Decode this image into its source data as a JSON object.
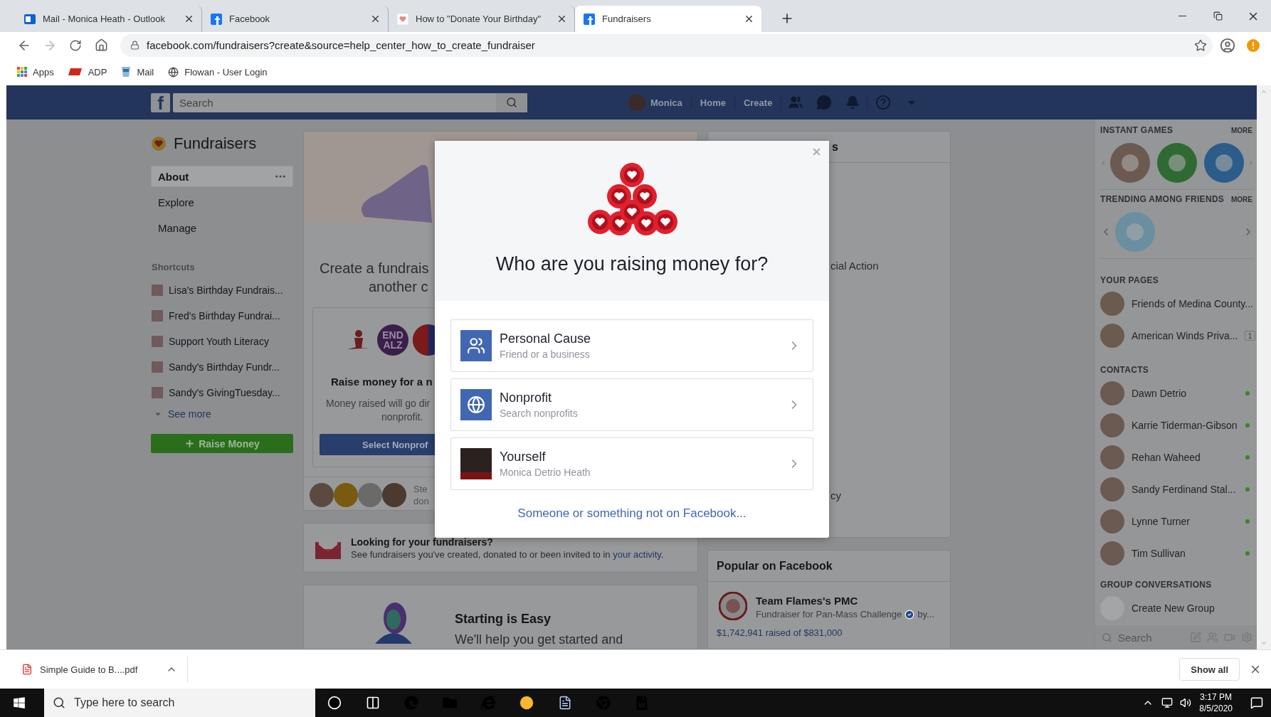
{
  "browser": {
    "tabs": [
      {
        "title": "Mail - Monica Heath - Outlook",
        "kind": "mail",
        "selected": false
      },
      {
        "title": "Facebook",
        "kind": "facebook",
        "selected": false
      },
      {
        "title": "How to \"Donate Your Birthday\"",
        "kind": "help",
        "selected": false
      },
      {
        "title": "Fundraisers",
        "kind": "facebook",
        "selected": true
      }
    ],
    "url": "facebook.com/fundraisers?create&source=help_center_how_to_create_fundraiser",
    "bookmarks": [
      {
        "label": "Apps",
        "kind": "apps"
      },
      {
        "label": "ADP",
        "kind": "adp"
      },
      {
        "label": "Mail",
        "kind": "cup"
      },
      {
        "label": "Flowan - User Login",
        "kind": "globe"
      }
    ]
  },
  "topbar": {
    "logo": "f",
    "search_placeholder": "Search",
    "profile_name": "Monica",
    "links": [
      "Home",
      "Create"
    ]
  },
  "sidebar": {
    "title": "Fundraisers",
    "nav": [
      {
        "label": "About",
        "selected": true
      },
      {
        "label": "Explore",
        "selected": false
      },
      {
        "label": "Manage",
        "selected": false
      }
    ],
    "shortcuts_heading": "Shortcuts",
    "shortcuts": [
      {
        "label": "Lisa's Birthday Fundrais..."
      },
      {
        "label": "Fred's Birthday Fundrai..."
      },
      {
        "label": "Support Youth Literacy"
      },
      {
        "label": "Sandy's Birthday Fundr..."
      },
      {
        "label": "Sandy's GivingTuesday..."
      }
    ],
    "see_more": "See more",
    "raise_button": "Raise Money"
  },
  "create_card": {
    "heading_lines": [
      "Create a fundrais",
      "another c"
    ],
    "logos": [
      {
        "kind": "figure"
      },
      {
        "kind": "text",
        "lines": [
          "END",
          "ALZ"
        ]
      },
      {
        "kind": "seal"
      }
    ],
    "title": "Raise money for a n",
    "body_lines": [
      "Money raised will go dir",
      "nonprofit."
    ],
    "button": "Select Nonprof",
    "donors_text_lines": [
      "Ste",
      "don"
    ]
  },
  "activity_card": {
    "title": "Looking for your fundraisers?",
    "text": "See fundraisers you've created, donated to or been invited to in",
    "link": "your activity",
    "after": "."
  },
  "starting_card": {
    "title": "Starting is Easy",
    "text": "We'll help you get started and"
  },
  "side_card": {
    "header": "s",
    "lines": [
      "cial Action",
      "cy"
    ]
  },
  "popular": {
    "heading": "Popular on Facebook",
    "item": {
      "title": "Team Flames's PMC",
      "subtitle": "Fundraiser for Pan-Mass Challenge",
      "verified": true,
      "after": "by...",
      "amount": "$1,742,941 raised of $831,000"
    }
  },
  "chat": {
    "games_heading": "INSTANT GAMES",
    "games_more": "MORE",
    "games": [
      {
        "kind": "word"
      },
      {
        "kind": "cards"
      },
      {
        "kind": "pool"
      }
    ],
    "trending_heading": "TRENDING AMONG FRIENDS",
    "trending_more": "MORE",
    "trending": [
      {
        "kind": "sweets"
      }
    ],
    "pages_heading": "YOUR PAGES",
    "pages": [
      {
        "name": "Friends of Medina County..."
      },
      {
        "name": "American Winds Priva...",
        "badge": "1"
      }
    ],
    "contacts_heading": "CONTACTS",
    "contacts": [
      {
        "name": "Dawn Detrio",
        "online": true
      },
      {
        "name": "Karrie Tiderman-Gibson",
        "online": true
      },
      {
        "name": "Rehan Waheed",
        "online": true
      },
      {
        "name": "Sandy Ferdinand Stal...",
        "online": true
      },
      {
        "name": "Lynne Turner",
        "online": true
      },
      {
        "name": "Tim Sullivan",
        "online": true
      }
    ],
    "groups_heading": "GROUP CONVERSATIONS",
    "create_group": "Create New Group",
    "search_placeholder": "Search"
  },
  "modal": {
    "title": "Who are you raising money for?",
    "options": [
      {
        "kind": "people",
        "title": "Personal Cause",
        "subtitle": "Friend or a business"
      },
      {
        "kind": "globe",
        "title": "Nonprofit",
        "subtitle": "Search nonprofits"
      },
      {
        "kind": "photo",
        "title": "Yourself",
        "subtitle": "Monica Detrio Heath"
      }
    ],
    "link": "Someone or something not on Facebook..."
  },
  "downloads": {
    "file": "Simple Guide to B....pdf",
    "show_all": "Show all"
  },
  "taskbar": {
    "search_placeholder": "Type here to search",
    "apps": [
      {
        "kind": "ring"
      },
      {
        "kind": "taskview"
      },
      {
        "kind": "edge"
      },
      {
        "kind": "folder"
      },
      {
        "kind": "ie"
      },
      {
        "kind": "yellow"
      },
      {
        "kind": "notepad"
      },
      {
        "kind": "chrome"
      },
      {
        "kind": "word"
      }
    ],
    "time": "3:17 PM",
    "date": "8/5/2020"
  }
}
